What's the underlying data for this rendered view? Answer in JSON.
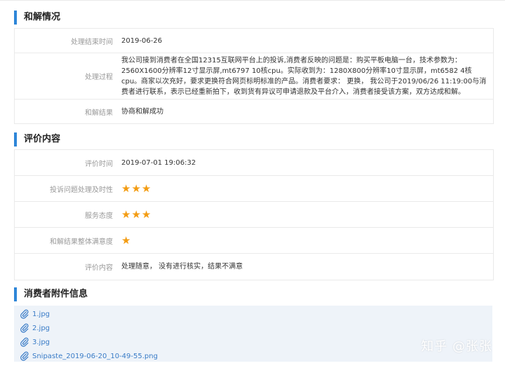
{
  "settlement": {
    "title": "和解情况",
    "rows": [
      {
        "label": "处理结束时间",
        "value": "2019-06-26"
      },
      {
        "label": "处理过程",
        "value": "我公司接到消费者在全国12315互联网平台上的投诉,消费者反映的问题是：购买平板电脑一台，技术参数为：2560X1600分辨率12寸显示屏,mt6797 10核cpu。实际收到为：1280X800分辨率10寸显示屏，mt6582 4核cpu。商家以次充好，要求更换符合网页标明标准的产品。消费者要求：  更换， 我公司于2019/06/26 11:19:00与消费者进行联系，表示已经重新拍下，收到货有异议可申请退款及平台介入，消费者接受该方案，双方达成和解。"
      },
      {
        "label": "和解结果",
        "value": "协商和解成功"
      }
    ]
  },
  "evaluation": {
    "title": "评价内容",
    "time_label": "评价时间",
    "time_value": "2019-07-01 19:06:32",
    "rating_rows": [
      {
        "label": "投诉问题处理及时性",
        "stars": 3
      },
      {
        "label": "服务态度",
        "stars": 3
      },
      {
        "label": "和解结果整体满意度",
        "stars": 1
      }
    ],
    "content_label": "评价内容",
    "content_value": "处理随意， 没有进行核实，结果不满意"
  },
  "attachments": {
    "title": "消费者附件信息",
    "files": [
      "1.jpg",
      "2.jpg",
      "3.jpg",
      "Snipaste_2019-06-20_10-49-55.png"
    ],
    "icon": "paperclip-icon"
  },
  "watermark": "知乎 @张张",
  "colors": {
    "accent": "#2e86d8",
    "star": "#f39c12",
    "link": "#3a7cc7",
    "attach_bg": "#eef3f9"
  }
}
